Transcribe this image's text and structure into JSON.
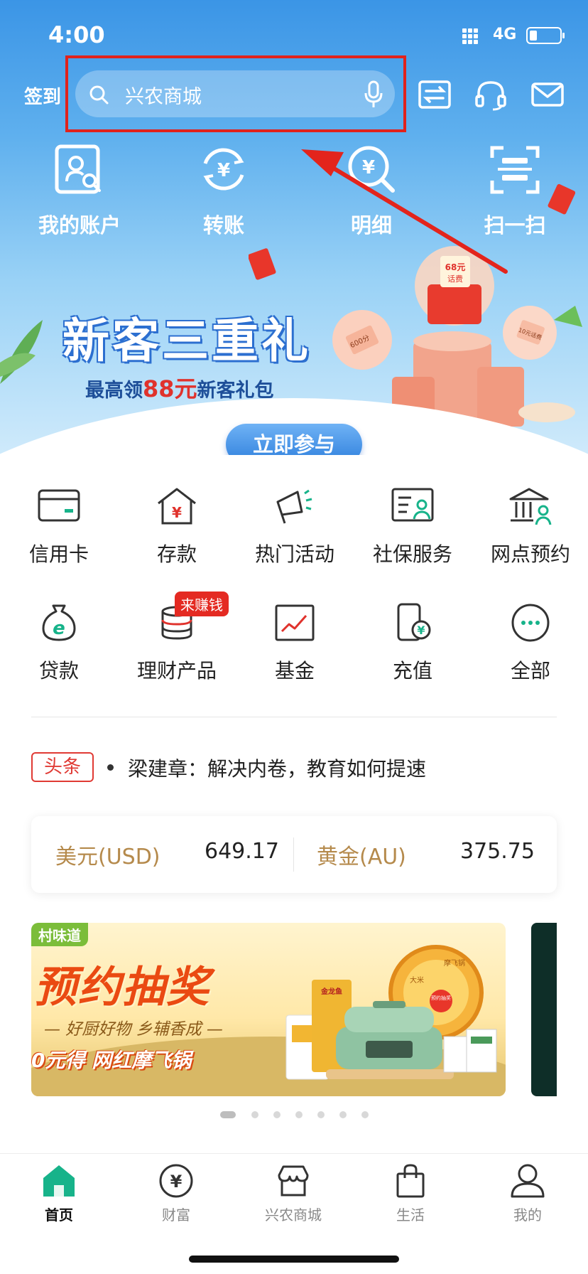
{
  "status_bar": {
    "time": "4:00",
    "network": "4G"
  },
  "header": {
    "checkin_label": "签到",
    "search_placeholder": "兴农商城"
  },
  "quick_actions": [
    {
      "label": "我的账户",
      "icon": "account-icon"
    },
    {
      "label": "转账",
      "icon": "transfer-icon"
    },
    {
      "label": "明细",
      "icon": "details-icon"
    },
    {
      "label": "扫一扫",
      "icon": "scan-icon"
    }
  ],
  "banner": {
    "title": "新客三重礼",
    "subtitle_prefix": "最高领",
    "subtitle_amount": "88元",
    "subtitle_suffix": "新客礼包",
    "join_button": "立即参与",
    "art_texts": [
      "68元",
      "话费",
      "600分",
      "10元话费"
    ]
  },
  "services": [
    {
      "label": "信用卡",
      "icon": "credit-card-icon"
    },
    {
      "label": "存款",
      "icon": "deposit-icon"
    },
    {
      "label": "热门活动",
      "icon": "megaphone-icon"
    },
    {
      "label": "社保服务",
      "icon": "social-security-icon"
    },
    {
      "label": "网点预约",
      "icon": "branch-icon"
    },
    {
      "label": "贷款",
      "icon": "loan-icon"
    },
    {
      "label": "理财产品",
      "icon": "wealth-products-icon"
    },
    {
      "label": "基金",
      "icon": "fund-chart-icon"
    },
    {
      "label": "充值",
      "icon": "top-up-icon"
    },
    {
      "label": "全部",
      "icon": "more-icon"
    }
  ],
  "services_badge": "来赚钱",
  "news": {
    "tag": "头条",
    "headline": "梁建章：解决内卷，教育如何提速"
  },
  "rates": {
    "usd_label": "美元(USD)",
    "usd_value": "649.17",
    "gold_label": "黄金(AU)",
    "gold_value": "375.75"
  },
  "promo": {
    "tag": "村味道",
    "title": "预约抽奖",
    "subtitle": "— 好厨好物 乡辅香成 —",
    "prize": "0元得 网红摩飞锅",
    "wheel_texts": [
      "摩飞锅",
      "大米",
      "预约抽奖"
    ],
    "product_text": "金龙鱼"
  },
  "carousel": {
    "count": 7,
    "active_index": 0
  },
  "tabs": [
    {
      "label": "首页",
      "icon": "home-icon",
      "active": true
    },
    {
      "label": "财富",
      "icon": "wealth-icon",
      "active": false
    },
    {
      "label": "兴农商城",
      "icon": "shop-icon",
      "active": false
    },
    {
      "label": "生活",
      "icon": "life-bag-icon",
      "active": false
    },
    {
      "label": "我的",
      "icon": "profile-icon",
      "active": false
    }
  ],
  "colors": {
    "hero_blue": "#3b95e6",
    "highlight_red": "#e0221c",
    "accent_green": "#17b38a",
    "gold_label": "#b58a4c"
  }
}
